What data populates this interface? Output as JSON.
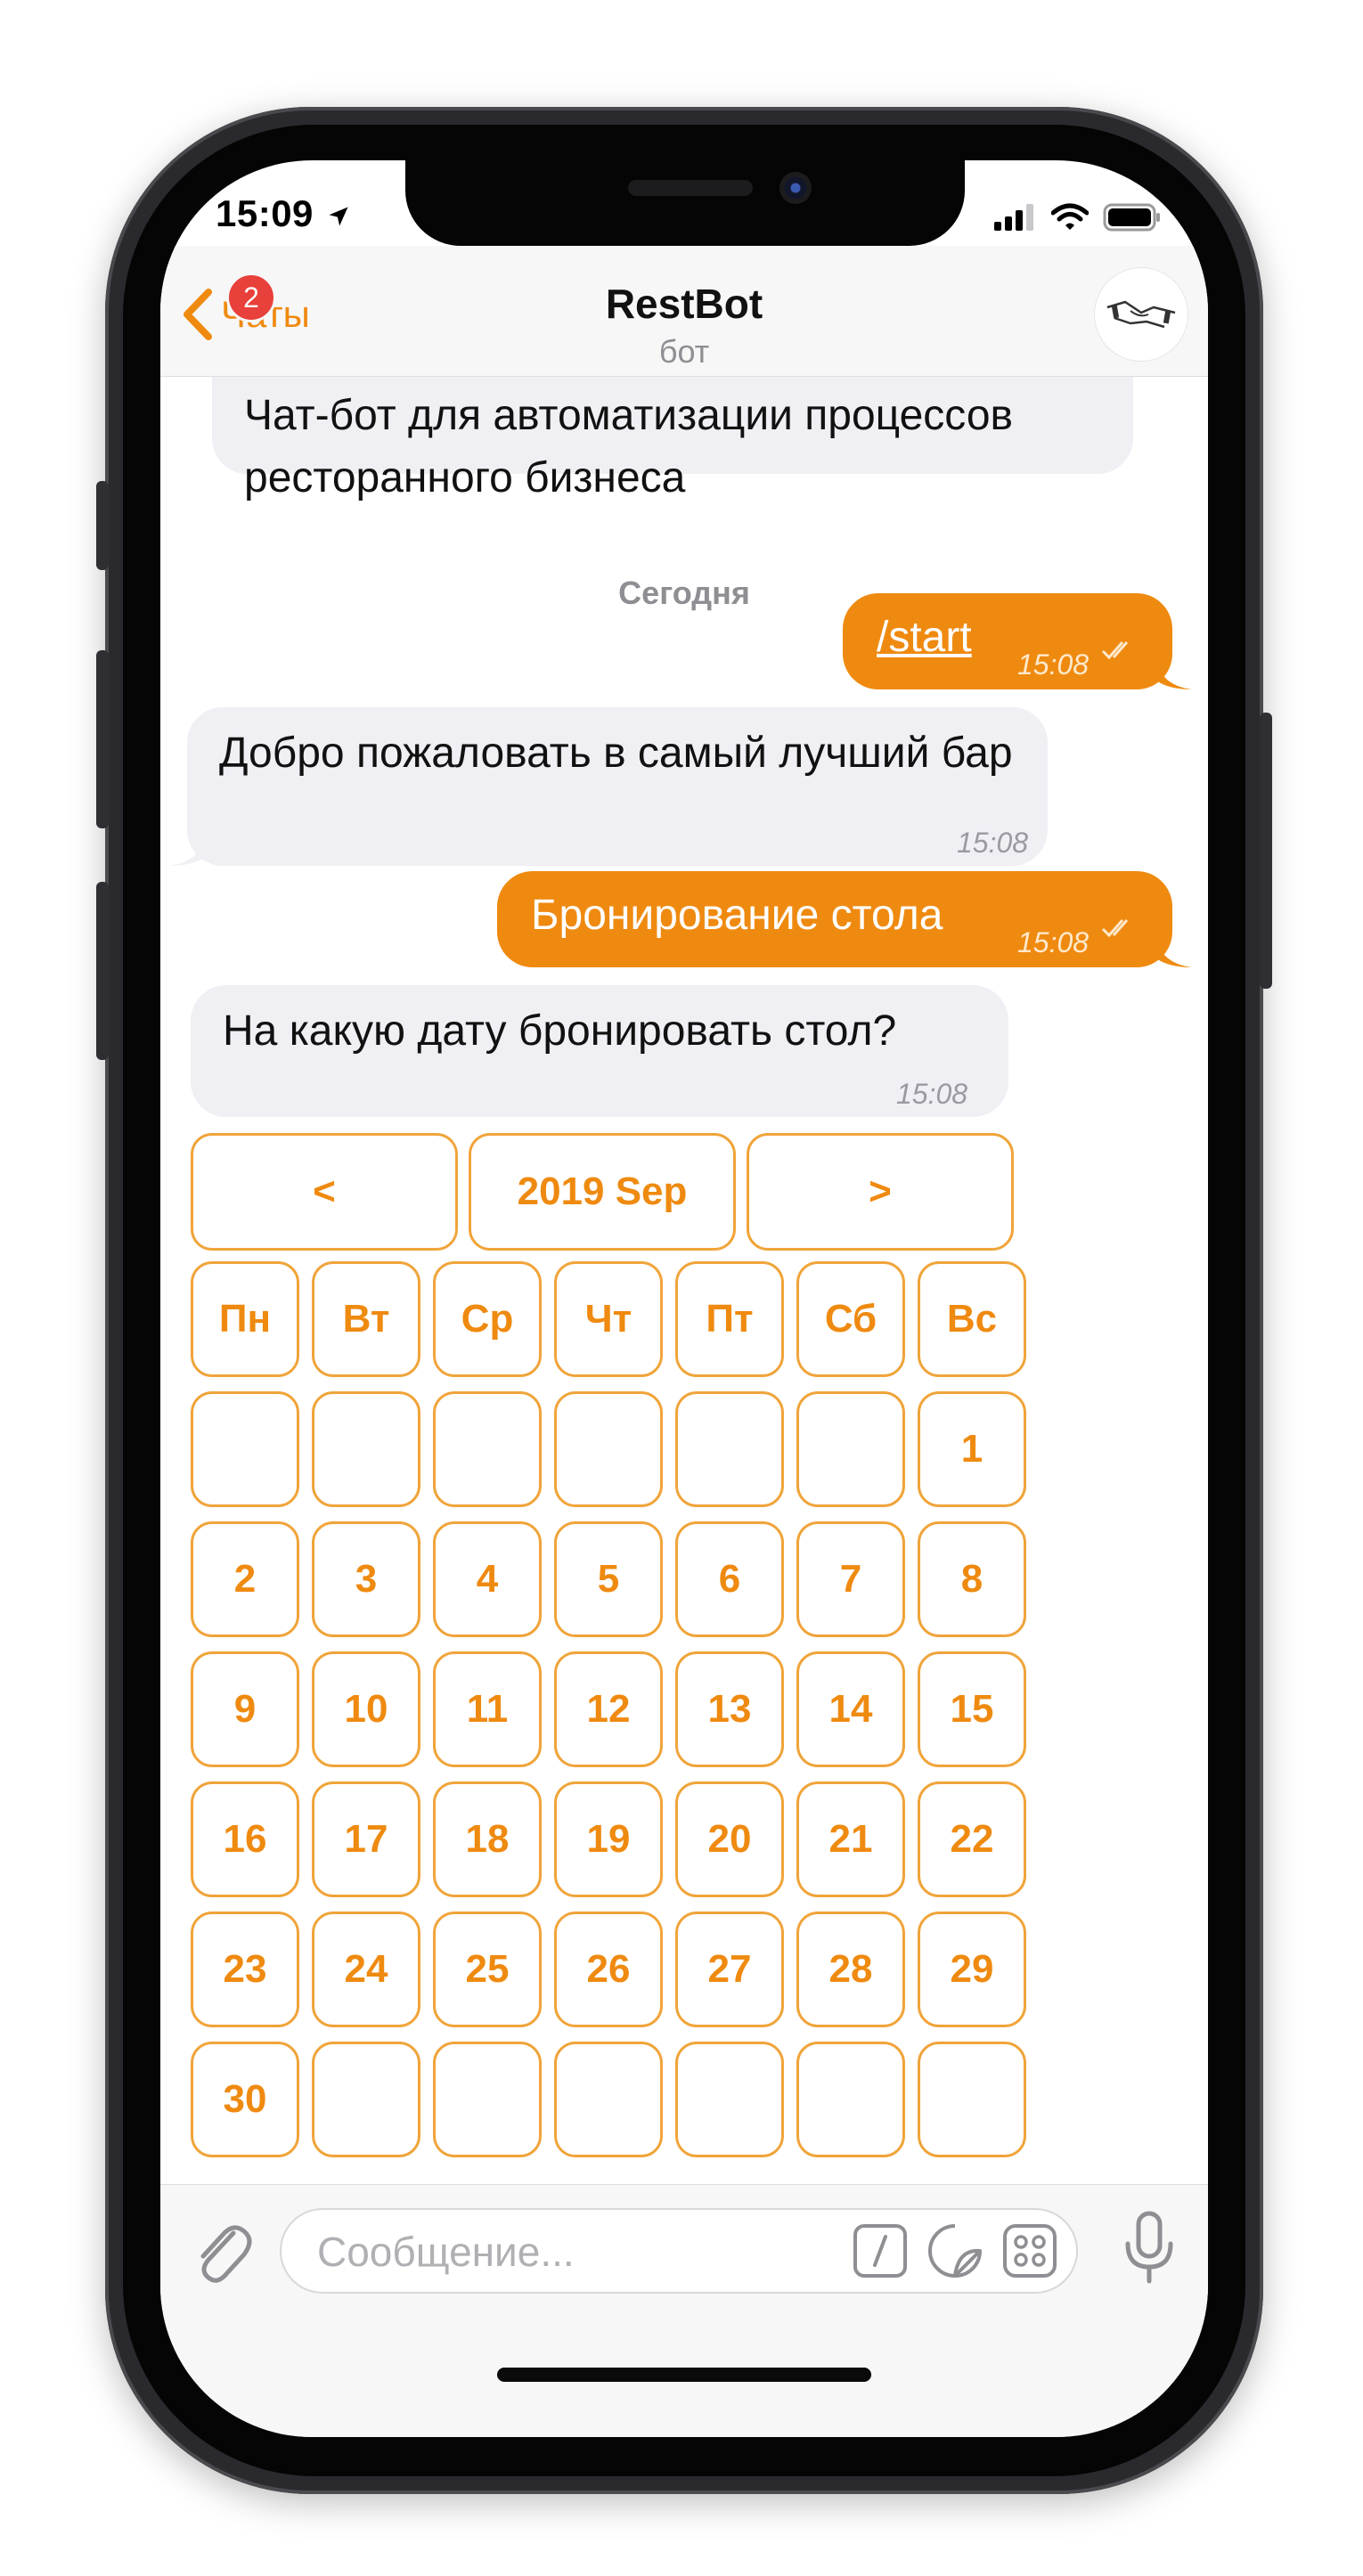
{
  "status_bar": {
    "time": "15:09"
  },
  "nav": {
    "back_label": "Чаты",
    "unread_count": "2",
    "title": "RestBot",
    "subtitle": "бот"
  },
  "messages": {
    "intro_text": "Чат-бот для автоматизации процессов ресторанного бизнеса",
    "date_separator": "Сегодня",
    "m1_text": "/start",
    "m1_time": "15:08",
    "m2_text": "Добро пожаловать в самый лучший бар",
    "m2_time": "15:08",
    "m3_text": "Бронирование стола",
    "m3_time": "15:08",
    "m4_text": "На какую дату бронировать стол?",
    "m4_time": "15:08"
  },
  "calendar": {
    "prev": "<",
    "month": "2019 Sep",
    "next": ">",
    "weekdays": [
      "Пн",
      "Вт",
      "Ср",
      "Чт",
      "Пт",
      "Сб",
      "Вс"
    ],
    "days": [
      "",
      "",
      "",
      "",
      "",
      "",
      "1",
      "2",
      "3",
      "4",
      "5",
      "6",
      "7",
      "8",
      "9",
      "10",
      "11",
      "12",
      "13",
      "14",
      "15",
      "16",
      "17",
      "18",
      "19",
      "20",
      "21",
      "22",
      "23",
      "24",
      "25",
      "26",
      "27",
      "28",
      "29",
      "30",
      "",
      "",
      "",
      "",
      "",
      ""
    ]
  },
  "input": {
    "placeholder": "Сообщение..."
  },
  "colors": {
    "accent": "#ef8a10",
    "incoming_bubble": "#efeff4",
    "badge": "#e8403a"
  },
  "icons": [
    "location-arrow-icon",
    "signal-icon",
    "wifi-icon",
    "battery-icon",
    "back-chevron-icon",
    "read-checks-icon",
    "attachment-icon",
    "slash-command-icon",
    "sticker-icon",
    "keyboard-icon",
    "microphone-icon"
  ]
}
